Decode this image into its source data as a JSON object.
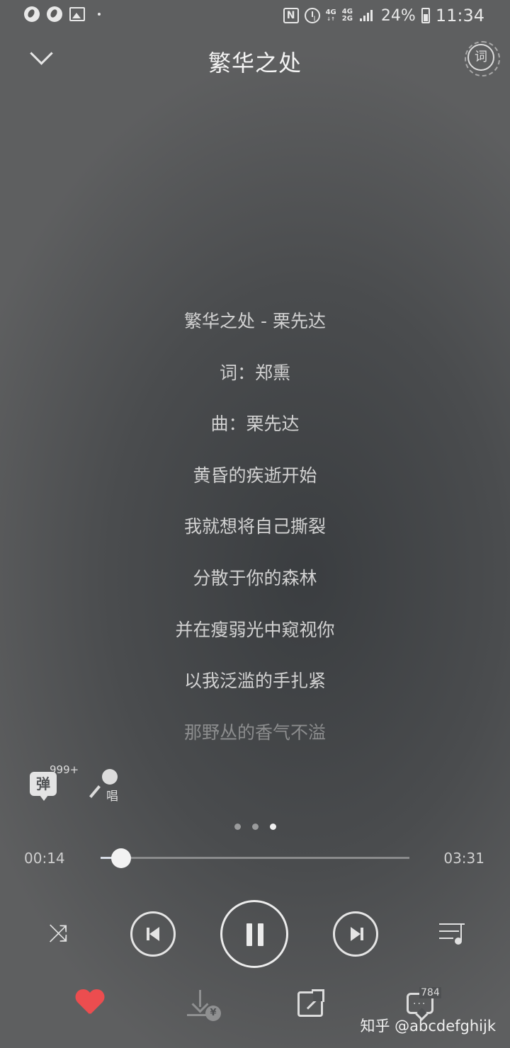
{
  "status_bar": {
    "battery": "24%",
    "time": "11:34",
    "net_top": "4G",
    "net_mid": "4G",
    "net_bottom": "2G"
  },
  "header": {
    "title": "繁华之处",
    "lyric_button": "词"
  },
  "lyrics": [
    "繁华之处 - 栗先达",
    "词：郑熏",
    "曲：栗先达",
    "黄昏的疾逝开始",
    "我就想将自己撕裂",
    "分散于你的森林",
    "并在瘦弱光中窥视你",
    "以我泛滥的手扎紧",
    "那野丛的香气不溢"
  ],
  "actions": {
    "danmu_label": "弹",
    "danmu_count": "999+",
    "sing_label": "唱"
  },
  "player": {
    "current_time": "00:14",
    "total_time": "03:31",
    "progress_fraction": 0.066,
    "page_count": 3,
    "active_page": 3
  },
  "bottom": {
    "comment_count": "784",
    "yen_symbol": "¥",
    "watermark": "知乎 @abcdefghijk"
  },
  "colors": {
    "heart": "#ec4d4f",
    "background": "#4a4c4e"
  }
}
